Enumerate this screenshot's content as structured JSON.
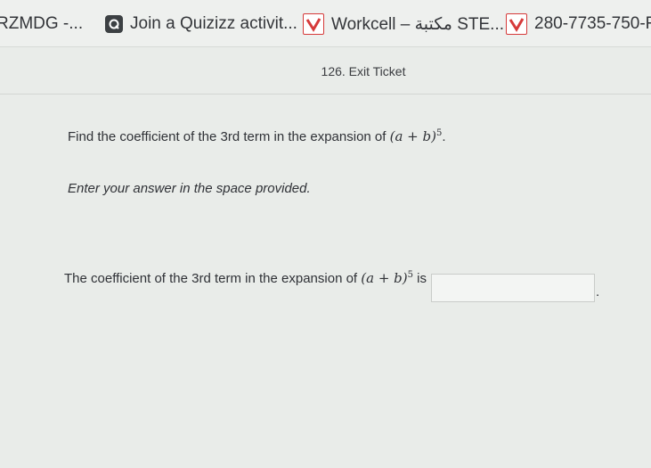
{
  "bookmarks": [
    {
      "label": "RZMDG -...",
      "icon": "none"
    },
    {
      "label": "Join a Quizizz activit...",
      "icon": "quizizz-icon"
    },
    {
      "label": "Workcell – مكتبة STE...",
      "icon": "check-icon"
    },
    {
      "label": "280-7735-750-R",
      "icon": "check-icon"
    }
  ],
  "page": {
    "title": "126. Exit Ticket"
  },
  "question": {
    "text": "Find the coefficient of the 3rd term in the expansion of",
    "expr": "(a + b)",
    "exponent": "5",
    "end": "."
  },
  "instruction": "Enter your answer in the space provided.",
  "answer": {
    "prefix": "The coefficient of the 3rd term in the expansion of",
    "expr": "(a + b)",
    "exponent": "5",
    "suffix": "is",
    "value": "",
    "end": "."
  },
  "colors": {
    "check_accent": "#d63a3a",
    "quizizz_icon": "#3c4043"
  }
}
